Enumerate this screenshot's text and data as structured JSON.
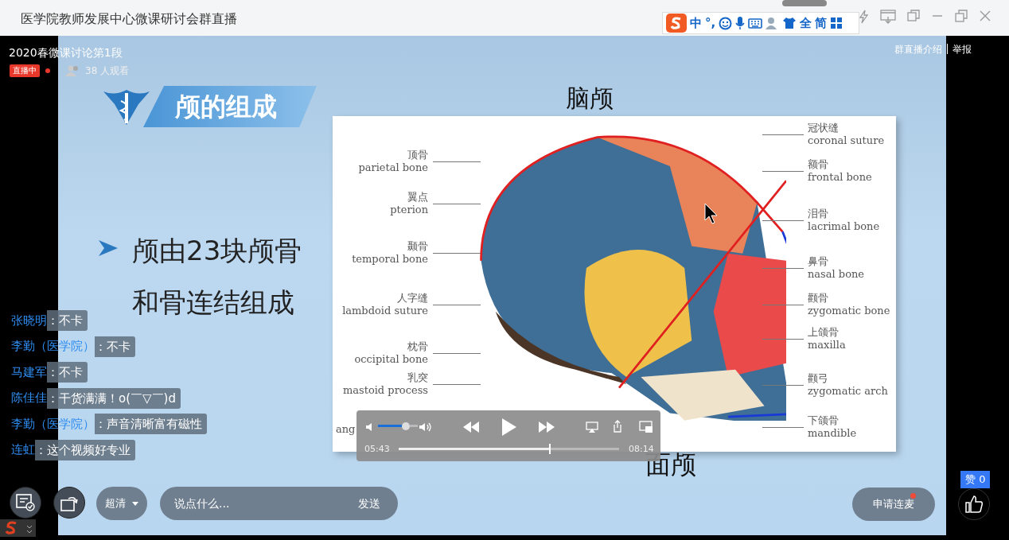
{
  "window": {
    "title": "医学院教师发展中心微课研讨会群直播"
  },
  "ime_toolbar": {
    "mode": "中",
    "punctuation": "°,",
    "width": "全",
    "script": "简"
  },
  "stream": {
    "title": "2020春微课讨论第1段",
    "live_badge": "直播中",
    "viewers": "38 人观看",
    "links": [
      "群直播介绍",
      "举报"
    ]
  },
  "slide": {
    "title": "颅的组成",
    "bullet_lines": [
      "颅由23块颅骨",
      "和骨连结组成"
    ],
    "figure": {
      "top_caption": "脑颅",
      "bottom_caption": "面颅",
      "cut_label": "ang",
      "left_labels": [
        {
          "zh": "顶骨",
          "en": "parietal bone"
        },
        {
          "zh": "翼点",
          "en": "pterion"
        },
        {
          "zh": "颞骨",
          "en": "temporal bone"
        },
        {
          "zh": "人字缝",
          "en": "lambdoid suture"
        },
        {
          "zh": "枕骨",
          "en": "occipital bone"
        },
        {
          "zh": "乳突",
          "en": "mastoid process"
        }
      ],
      "right_labels": [
        {
          "zh": "冠状缝",
          "en": "coronal suture"
        },
        {
          "zh": "额骨",
          "en": "frontal bone"
        },
        {
          "zh": "泪骨",
          "en": "lacrimal bone"
        },
        {
          "zh": "鼻骨",
          "en": "nasal bone"
        },
        {
          "zh": "颧骨",
          "en": "zygomatic bone"
        },
        {
          "zh": "上颌骨",
          "en": "maxilla"
        },
        {
          "zh": "颧弓",
          "en": "zygomatic arch"
        },
        {
          "zh": "下颌骨",
          "en": "mandible"
        }
      ]
    }
  },
  "player": {
    "elapsed": "05:43",
    "duration": "08:14"
  },
  "chat": [
    {
      "name": "张晓明",
      "text": "：不卡"
    },
    {
      "name": "李勤（医学院）",
      "text": "：不卡"
    },
    {
      "name": "马建军",
      "text": "：不卡"
    },
    {
      "name": "陈佳佳",
      "text": "：干货满满！o(￣▽￣)d"
    },
    {
      "name": "李勤（医学院）",
      "text": "：声音清晰富有磁性"
    },
    {
      "name": "连虹",
      "text": "：这个视频好专业"
    }
  ],
  "controls": {
    "quality": "超清",
    "comment_placeholder": "说点什么...",
    "send": "发送",
    "mic_request": {
      "label": "申请连麦",
      "has_notification": true
    },
    "likes": "赞 0"
  }
}
